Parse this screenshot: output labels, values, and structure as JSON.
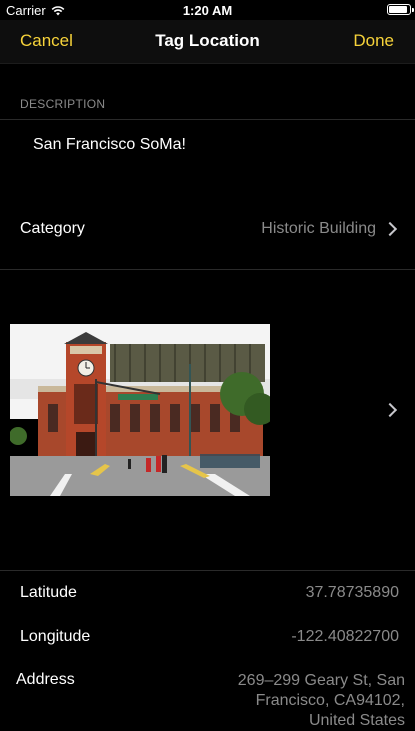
{
  "status_bar": {
    "carrier": "Carrier",
    "time": "1:20 AM",
    "battery_level": 0.88
  },
  "navbar": {
    "cancel_label": "Cancel",
    "title": "Tag Location",
    "done_label": "Done",
    "accent_color": "#f7d33a"
  },
  "description_section": {
    "header": "DESCRIPTION",
    "text": "San Francisco SoMa!"
  },
  "category": {
    "label": "Category",
    "value": "Historic Building"
  },
  "photo": {
    "icon": "photo-thumbnail"
  },
  "location": {
    "latitude_label": "Latitude",
    "latitude_value": "37.78735890",
    "longitude_label": "Longitude",
    "longitude_value": "-122.40822700",
    "address_label": "Address",
    "address_value": "269–299 Geary St, San Francisco, CA94102, United States"
  }
}
